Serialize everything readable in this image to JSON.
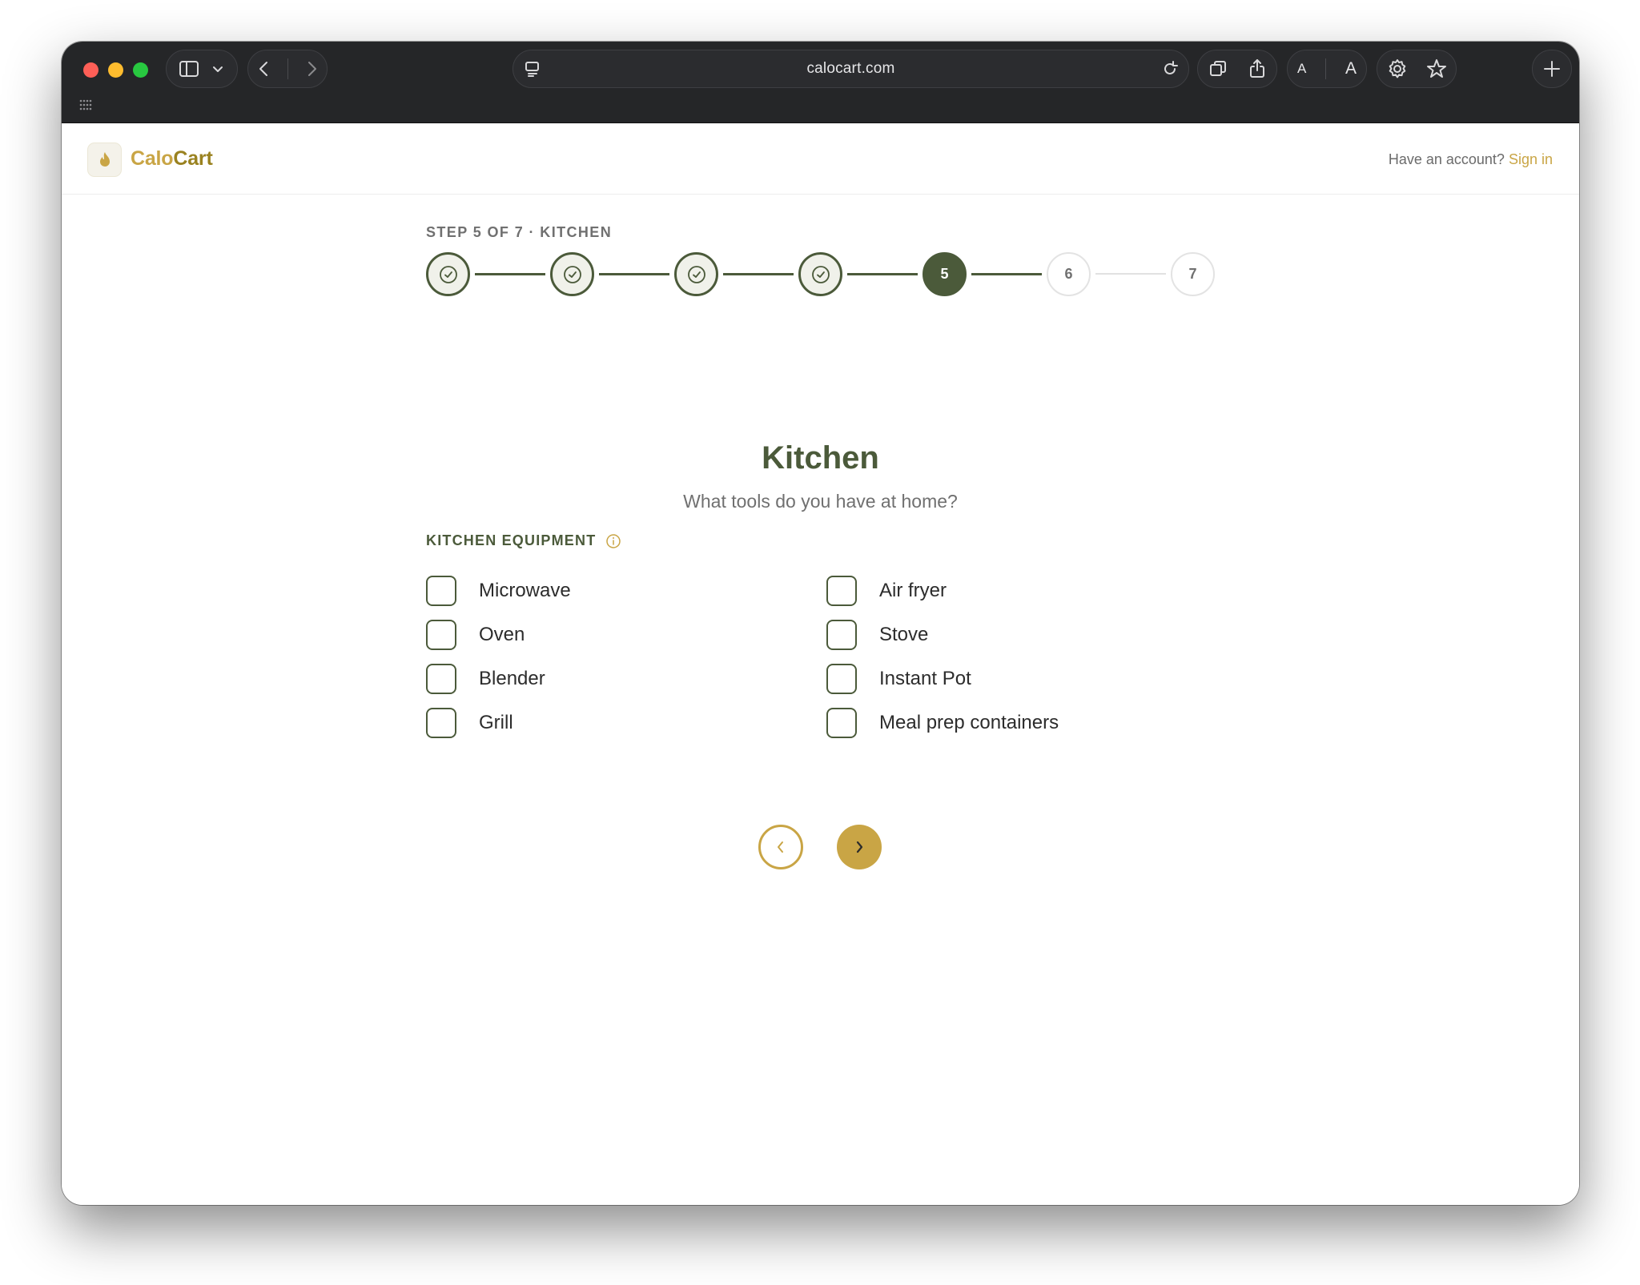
{
  "browser": {
    "url": "calocart.com"
  },
  "header": {
    "brand_part1": "Calo",
    "brand_part2": "Cart",
    "account_prompt": "Have an account?",
    "sign_in_label": "Sign in"
  },
  "stepper": {
    "label": "STEP 5 OF 7 · KITCHEN",
    "current_step": 5,
    "total_steps": 7,
    "steps": [
      {
        "label": "1",
        "state": "done"
      },
      {
        "label": "2",
        "state": "done"
      },
      {
        "label": "3",
        "state": "done"
      },
      {
        "label": "4",
        "state": "done"
      },
      {
        "label": "5",
        "state": "current"
      },
      {
        "label": "6",
        "state": "todo"
      },
      {
        "label": "7",
        "state": "todo"
      }
    ]
  },
  "main": {
    "title": "Kitchen",
    "subtitle": "What tools do you have at home?",
    "section_label": "KITCHEN EQUIPMENT",
    "options": [
      {
        "label": "Microwave",
        "checked": false
      },
      {
        "label": "Air fryer",
        "checked": false
      },
      {
        "label": "Oven",
        "checked": false
      },
      {
        "label": "Stove",
        "checked": false
      },
      {
        "label": "Blender",
        "checked": false
      },
      {
        "label": "Instant Pot",
        "checked": false
      },
      {
        "label": "Grill",
        "checked": false
      },
      {
        "label": "Meal prep containers",
        "checked": false
      }
    ]
  },
  "colors": {
    "primary": "#4b5a3a",
    "accent": "#c9a545",
    "browser_chrome": "#252628"
  }
}
